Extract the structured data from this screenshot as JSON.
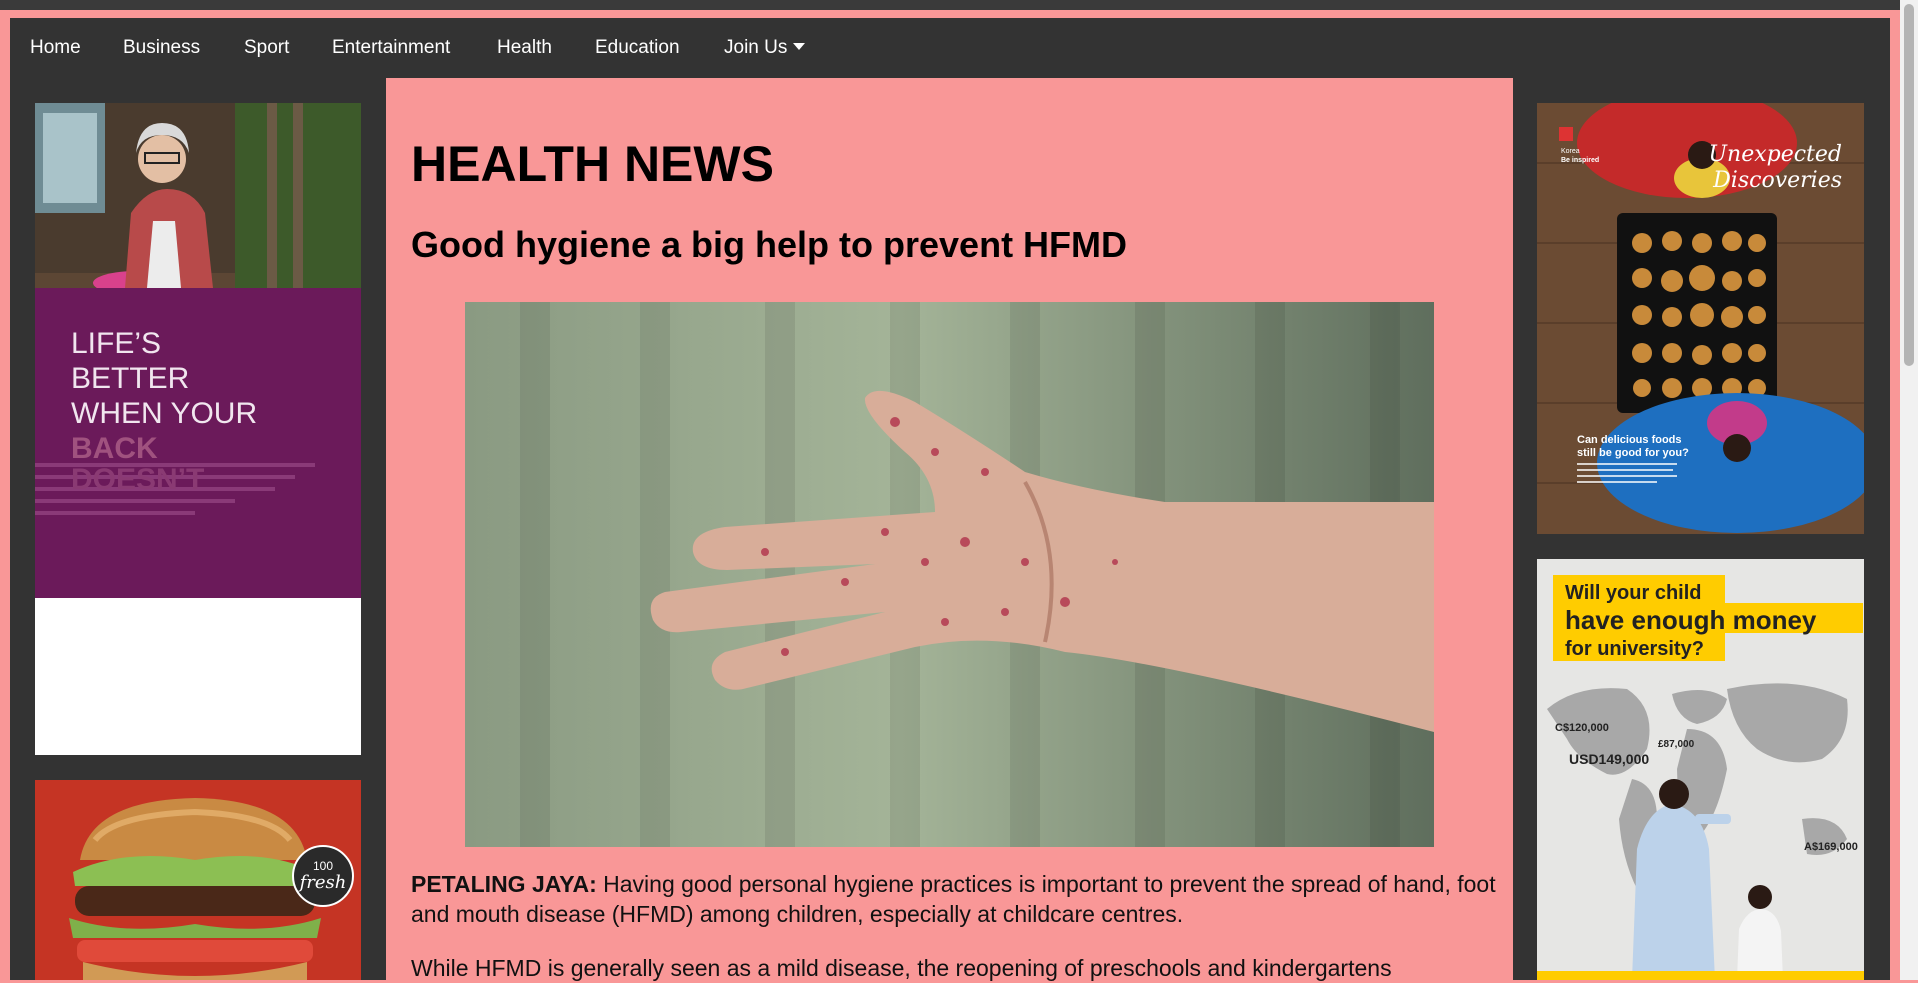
{
  "nav": {
    "items": [
      "Home",
      "Business",
      "Sport",
      "Entertainment",
      "Health",
      "Education"
    ],
    "join_label": "Join Us"
  },
  "article": {
    "section_title": "HEALTH NEWS",
    "headline": "Good hygiene a big help to prevent HFMD",
    "dateline": "PETALING JAYA:",
    "lead": " Having good personal hygiene practices is important to prevent the spread of hand, foot and mouth disease (HFMD) among children, especially at childcare centres.",
    "second_paragraph": "While HFMD is generally seen as a mild disease, the reopening of preschools and kindergartens"
  },
  "ads": {
    "left_back": {
      "line1": "LIFE’S",
      "line2": "BETTER",
      "line3": "WHEN YOUR",
      "line4": "BACK",
      "line5": "DOESN’T"
    },
    "left_food": {
      "badge_top": "100",
      "badge_bottom": "fresh"
    },
    "right_korea": {
      "brand_top": "Korea",
      "brand_bottom": "Be inspired",
      "title_line1": "Unexpected",
      "title_line2": "Discoveries",
      "question_line1": "Can delicious foods",
      "question_line2": "still be good for you?"
    },
    "right_university": {
      "line1": "Will your child",
      "line2": "have enough money",
      "line3": "for university?",
      "cost_ca": "C$120,000",
      "cost_uk": "£87,000",
      "cost_us": "USD149,000",
      "cost_au": "A$169,000"
    }
  },
  "colors": {
    "page_pink": "#f99797",
    "frame_dark": "#333333",
    "nav_text": "#ffffff",
    "ad_purple": "#6b1a5a",
    "ad_yellow": "#ffcc00"
  }
}
